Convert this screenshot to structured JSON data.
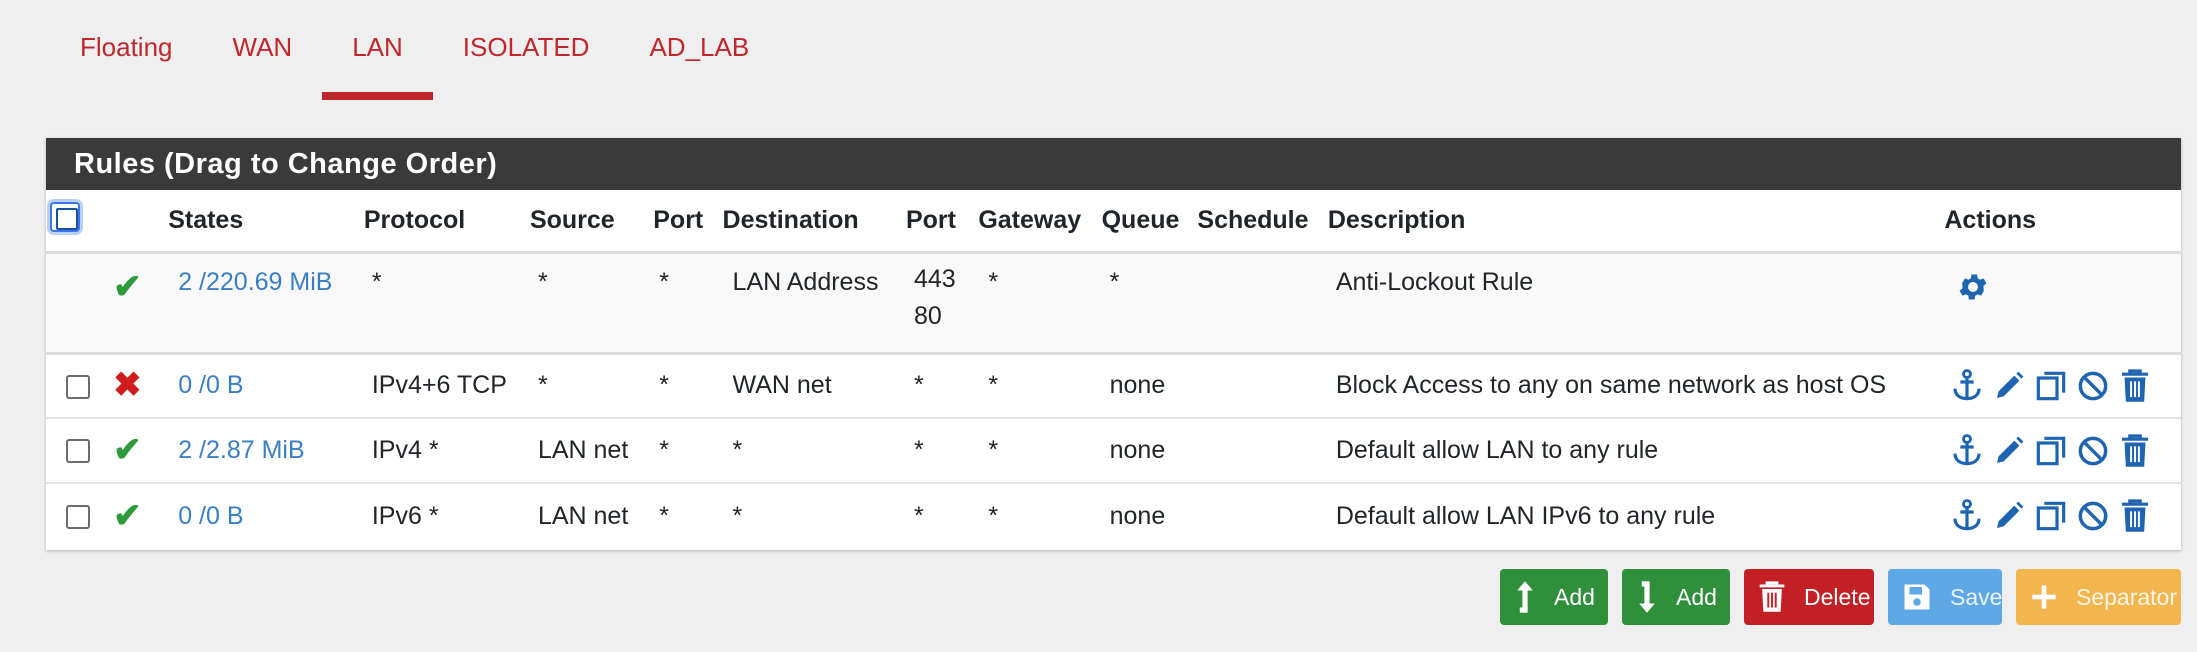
{
  "tabs": [
    "Floating",
    "WAN",
    "LAN",
    "ISOLATED",
    "AD_LAB"
  ],
  "active_tab": "LAN",
  "panel": {
    "title": "Rules (Drag to Change Order)"
  },
  "columns": {
    "states": "States",
    "protocol": "Protocol",
    "source": "Source",
    "port": "Port",
    "destination": "Destination",
    "dport": "Port",
    "gateway": "Gateway",
    "queue": "Queue",
    "schedule": "Schedule",
    "description": "Description",
    "actions": "Actions"
  },
  "rules": [
    {
      "status": "pass",
      "states": "2 /220.69 MiB",
      "protocol": "*",
      "source": "*",
      "port": "*",
      "destination": "LAN Address",
      "dport_line1": "443",
      "dport_line2": "80",
      "gateway": "*",
      "queue": "*",
      "schedule": "",
      "description": "Anti-Lockout Rule"
    },
    {
      "status": "block",
      "states": "0 /0 B",
      "protocol": "IPv4+6 TCP",
      "source": "*",
      "port": "*",
      "destination": "WAN net",
      "dport": "*",
      "gateway": "*",
      "queue": "none",
      "schedule": "",
      "description": "Block Access to any on same network as host OS"
    },
    {
      "status": "pass",
      "states": "2 /2.87 MiB",
      "protocol": "IPv4 *",
      "source": "LAN net",
      "port": "*",
      "destination": "*",
      "dport": "*",
      "gateway": "*",
      "queue": "none",
      "schedule": "",
      "description": "Default allow LAN to any rule"
    },
    {
      "status": "pass",
      "states": "0 /0 B",
      "protocol": "IPv6 *",
      "source": "LAN net",
      "port": "*",
      "destination": "*",
      "dport": "*",
      "gateway": "*",
      "queue": "none",
      "schedule": "",
      "description": "Default allow LAN IPv6 to any rule"
    }
  ],
  "buttons": {
    "add_top": "Add",
    "add_bottom": "Add",
    "delete": "Delete",
    "save": "Save",
    "separator": "Separator"
  },
  "colors": {
    "tab_red": "#c0272d",
    "pass_green": "#2e9a3a",
    "block_red": "#d01c1c",
    "link_blue": "#3a7fc4",
    "action_blue": "#1f64b0"
  }
}
